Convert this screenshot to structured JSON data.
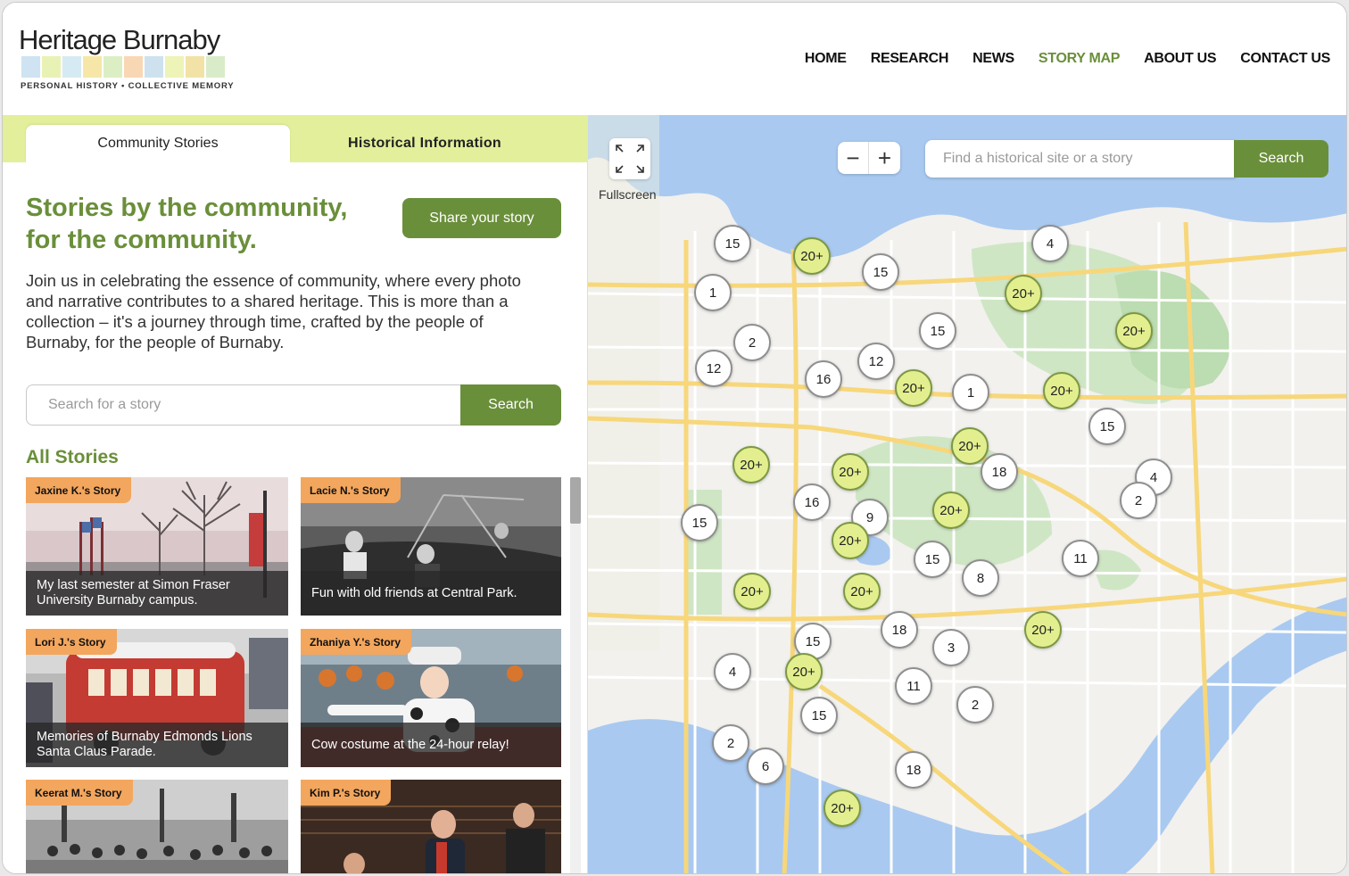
{
  "header": {
    "logo": {
      "title": "Heritage Burnaby",
      "tagline": "PERSONAL HISTORY • COLLECTIVE MEMORY",
      "bar_colors": [
        "#cfe3f2",
        "#e9f2b5",
        "#d6eaf3",
        "#f6e7a9",
        "#dcefc4",
        "#f8d7b5",
        "#cde2ee",
        "#eef3b8",
        "#f3e2a6",
        "#d9ecc9"
      ]
    },
    "nav": [
      {
        "label": "HOME",
        "active": false
      },
      {
        "label": "RESEARCH",
        "active": false
      },
      {
        "label": "NEWS",
        "active": false
      },
      {
        "label": "STORY MAP",
        "active": true
      },
      {
        "label": "ABOUT US",
        "active": false
      },
      {
        "label": "CONTACT US",
        "active": false
      }
    ]
  },
  "tabs": {
    "community": "Community Stories",
    "historical": "Historical Information"
  },
  "intro": {
    "headline": "Stories by the community, for the community.",
    "share_button": "Share your story",
    "body": "Join us in celebrating the essence of community, where every photo and narrative contributes to a shared heritage. This is more than a collection – it's a journey through time, crafted by the people of Burnaby, for the people of Burnaby."
  },
  "story_search": {
    "placeholder": "Search for a story",
    "button": "Search"
  },
  "stories": {
    "heading": "All Stories",
    "items": [
      {
        "tag": "Jaxine K.'s Story",
        "caption": "My last semester at Simon Fraser University Burnaby campus."
      },
      {
        "tag": "Lacie N.'s Story",
        "caption": "Fun with old friends at Central Park."
      },
      {
        "tag": "Lori J.'s Story",
        "caption": "Memories of Burnaby Edmonds Lions Santa Claus Parade."
      },
      {
        "tag": "Zhaniya Y.'s Story",
        "caption": "Cow costume at the 24-hour relay!"
      },
      {
        "tag": "Keerat M.'s Story",
        "caption": ""
      },
      {
        "tag": "Kim P.'s Story",
        "caption": ""
      }
    ]
  },
  "map": {
    "fullscreen_label": "Fullscreen",
    "zoom_out": "−",
    "zoom_in": "+",
    "search_placeholder": "Find a historical site or a story",
    "search_button": "Search",
    "colors": {
      "water": "#a9c9f0",
      "park": "#cfe6c5",
      "land": "#f2f1ee",
      "major_road": "#f7d77a",
      "minor_road": "#ffffff",
      "hot_marker": "#e3ef8f",
      "accent": "#6a8f3a"
    },
    "markers": [
      {
        "label": "15",
        "hot": false
      },
      {
        "label": "20+",
        "hot": true
      },
      {
        "label": "15",
        "hot": false
      },
      {
        "label": "4",
        "hot": false
      },
      {
        "label": "20+",
        "hot": true
      },
      {
        "label": "1",
        "hot": false
      },
      {
        "label": "20+",
        "hot": true
      },
      {
        "label": "15",
        "hot": false
      },
      {
        "label": "2",
        "hot": false
      },
      {
        "label": "12",
        "hot": false
      },
      {
        "label": "12",
        "hot": false
      },
      {
        "label": "16",
        "hot": false
      },
      {
        "label": "20+",
        "hot": true
      },
      {
        "label": "1",
        "hot": false
      },
      {
        "label": "20+",
        "hot": true
      },
      {
        "label": "15",
        "hot": false
      },
      {
        "label": "20+",
        "hot": true
      },
      {
        "label": "20+",
        "hot": true
      },
      {
        "label": "20+",
        "hot": true
      },
      {
        "label": "18",
        "hot": false
      },
      {
        "label": "4",
        "hot": false
      },
      {
        "label": "16",
        "hot": false
      },
      {
        "label": "9",
        "hot": false
      },
      {
        "label": "2",
        "hot": false
      },
      {
        "label": "20+",
        "hot": true
      },
      {
        "label": "15",
        "hot": false
      },
      {
        "label": "20+",
        "hot": true
      },
      {
        "label": "15",
        "hot": false
      },
      {
        "label": "11",
        "hot": false
      },
      {
        "label": "8",
        "hot": false
      },
      {
        "label": "20+",
        "hot": true
      },
      {
        "label": "20+",
        "hot": true
      },
      {
        "label": "18",
        "hot": false
      },
      {
        "label": "20+",
        "hot": true
      },
      {
        "label": "15",
        "hot": false
      },
      {
        "label": "3",
        "hot": false
      },
      {
        "label": "4",
        "hot": false
      },
      {
        "label": "20+",
        "hot": true
      },
      {
        "label": "11",
        "hot": false
      },
      {
        "label": "2",
        "hot": false
      },
      {
        "label": "15",
        "hot": false
      },
      {
        "label": "2",
        "hot": false
      },
      {
        "label": "6",
        "hot": false
      },
      {
        "label": "18",
        "hot": false
      },
      {
        "label": "20+",
        "hot": true
      }
    ]
  }
}
